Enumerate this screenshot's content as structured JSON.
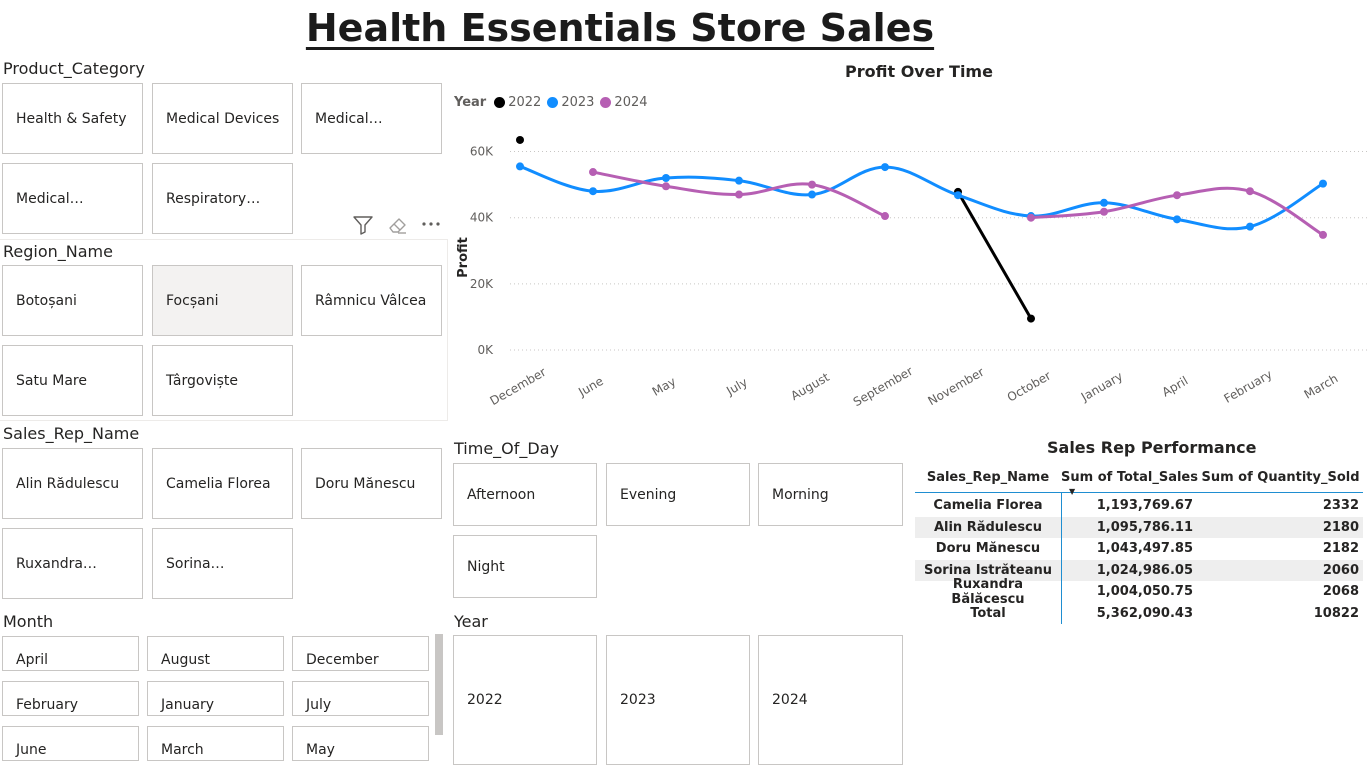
{
  "title": "Health Essentials Store Sales",
  "slicers": {
    "product_category": {
      "header": "Product_Category",
      "items": [
        "Health & Safety",
        "Medical Devices",
        "Medical…",
        "Medical…",
        "Respiratory…"
      ]
    },
    "region_name": {
      "header": "Region_Name",
      "items": [
        "Botoșani",
        "Focșani",
        "Râmnicu Vâlcea",
        "Satu Mare",
        "Târgoviște"
      ],
      "selected": "Focșani"
    },
    "sales_rep_name": {
      "header": "Sales_Rep_Name",
      "items": [
        "Alin Rădulescu",
        "Camelia Florea",
        "Doru Mănescu",
        "Ruxandra…",
        "Sorina…"
      ]
    },
    "month": {
      "header": "Month",
      "items": [
        "April",
        "August",
        "December",
        "February",
        "January",
        "July",
        "June",
        "March",
        "May"
      ]
    },
    "time_of_day": {
      "header": "Time_Of_Day",
      "items": [
        "Afternoon",
        "Evening",
        "Morning",
        "Night"
      ]
    },
    "year": {
      "header": "Year",
      "items": [
        "2022",
        "2023",
        "2024"
      ]
    }
  },
  "icons": {
    "filter": "filter-icon",
    "eraser": "eraser-icon",
    "more": "more-options-icon"
  },
  "chart_data": {
    "type": "line",
    "title": "Profit Over Time",
    "legend_title": "Year",
    "legend_position": "top-left",
    "xlabel": "",
    "ylabel": "Profit",
    "ylim": [
      0,
      65000
    ],
    "yticks": [
      0,
      20000,
      40000,
      60000
    ],
    "ytick_labels": [
      "0K",
      "20K",
      "40K",
      "60K"
    ],
    "grid": true,
    "categories": [
      "December",
      "June",
      "May",
      "July",
      "August",
      "September",
      "November",
      "October",
      "January",
      "April",
      "February",
      "March"
    ],
    "series": [
      {
        "name": "2022",
        "color": "#000000",
        "values": [
          63500,
          null,
          null,
          null,
          null,
          null,
          47800,
          9500,
          null,
          null,
          null,
          null
        ]
      },
      {
        "name": "2023",
        "color": "#118dff",
        "values": [
          55500,
          48000,
          52000,
          51200,
          47000,
          55300,
          46800,
          40500,
          44500,
          39500,
          37300,
          50300
        ]
      },
      {
        "name": "2024",
        "color": "#b65fb3",
        "values": [
          null,
          53800,
          49500,
          47000,
          50000,
          40500,
          null,
          40000,
          41800,
          46800,
          48000,
          34800
        ]
      }
    ]
  },
  "sales_rep_table": {
    "title": "Sales Rep Performance",
    "columns": [
      "Sales_Rep_Name",
      "Sum of Total_Sales",
      "Sum of Quantity_Sold"
    ],
    "sort_indicator": "▼",
    "rows": [
      [
        "Camelia Florea",
        "1,193,769.67",
        "2332"
      ],
      [
        "Alin Rădulescu",
        "1,095,786.11",
        "2180"
      ],
      [
        "Doru Mănescu",
        "1,043,497.85",
        "2182"
      ],
      [
        "Sorina Istrăteanu",
        "1,024,986.05",
        "2060"
      ],
      [
        "Ruxandra Bălăcescu",
        "1,004,050.75",
        "2068"
      ]
    ],
    "total": [
      "Total",
      "5,362,090.43",
      "10822"
    ]
  }
}
